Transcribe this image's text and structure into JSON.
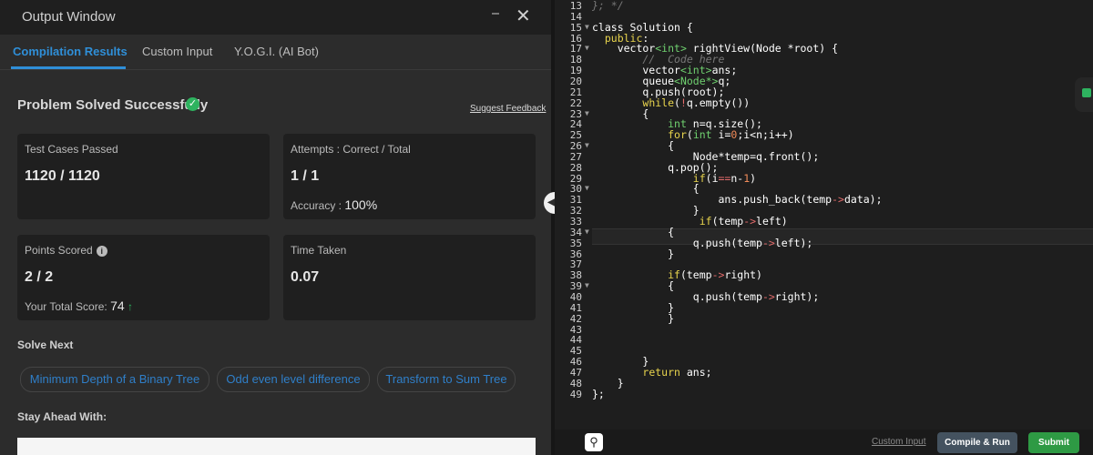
{
  "window": {
    "title": "Output Window"
  },
  "tabs": [
    "Compilation Results",
    "Custom Input",
    "Y.O.G.I. (AI Bot)"
  ],
  "result": {
    "status": "Problem Solved Successfully",
    "feedback_link": "Suggest Feedback",
    "test_cases": {
      "label": "Test Cases Passed",
      "value": "1120 / 1120"
    },
    "attempts": {
      "label": "Attempts : Correct / Total",
      "value": "1 / 1",
      "accuracy_label": "Accuracy :",
      "accuracy_value": "100%"
    },
    "points": {
      "label": "Points Scored",
      "value": "2 / 2",
      "total_label": "Your Total Score:",
      "total_value": "74"
    },
    "time": {
      "label": "Time Taken",
      "value": "0.07"
    }
  },
  "solve_next": {
    "heading": "Solve Next",
    "items": [
      "Minimum Depth of a Binary Tree",
      "Odd even level difference",
      "Transform to Sum Tree"
    ]
  },
  "stay_ahead": {
    "heading": "Stay Ahead With:"
  },
  "editor": {
    "line_numbers": [
      "13",
      "14",
      "15",
      "16",
      "17",
      "18",
      "19",
      "20",
      "21",
      "22",
      "23",
      "24",
      "25",
      "26",
      "27",
      "28",
      "29",
      "30",
      "31",
      "32",
      "33",
      "34",
      "35",
      "36",
      "37",
      "38",
      "39",
      "40",
      "41",
      "42",
      "43",
      "44",
      "45",
      "46",
      "47",
      "48",
      "49"
    ],
    "code": [
      "}; */",
      "",
      "class Solution {",
      "  public:",
      "    vector<int> rightView(Node *root) {",
      "        //  Code here",
      "        vector<int>ans;",
      "        queue<Node*>q;",
      "        q.push(root);",
      "        while(!q.empty())",
      "        {",
      "            int n=q.size();",
      "            for(int i=0;i<n;i++)",
      "            {",
      "                Node*temp=q.front();",
      "            q.pop();",
      "                if(i==n-1)",
      "                {",
      "                    ans.push_back(temp->data);",
      "                }",
      "                 if(temp->left)",
      "            {",
      "                q.push(temp->left);",
      "            }",
      "",
      "            if(temp->right)",
      "            {",
      "                q.push(temp->right);",
      "            }",
      "            }",
      "",
      "",
      "",
      "        }",
      "        return ans;",
      "    }",
      "};"
    ],
    "fold_lines": [
      "15",
      "17",
      "23",
      "26",
      "30",
      "34",
      "39"
    ]
  },
  "bottom": {
    "custom_input": "Custom Input",
    "compile": "Compile & Run",
    "submit": "Submit"
  }
}
